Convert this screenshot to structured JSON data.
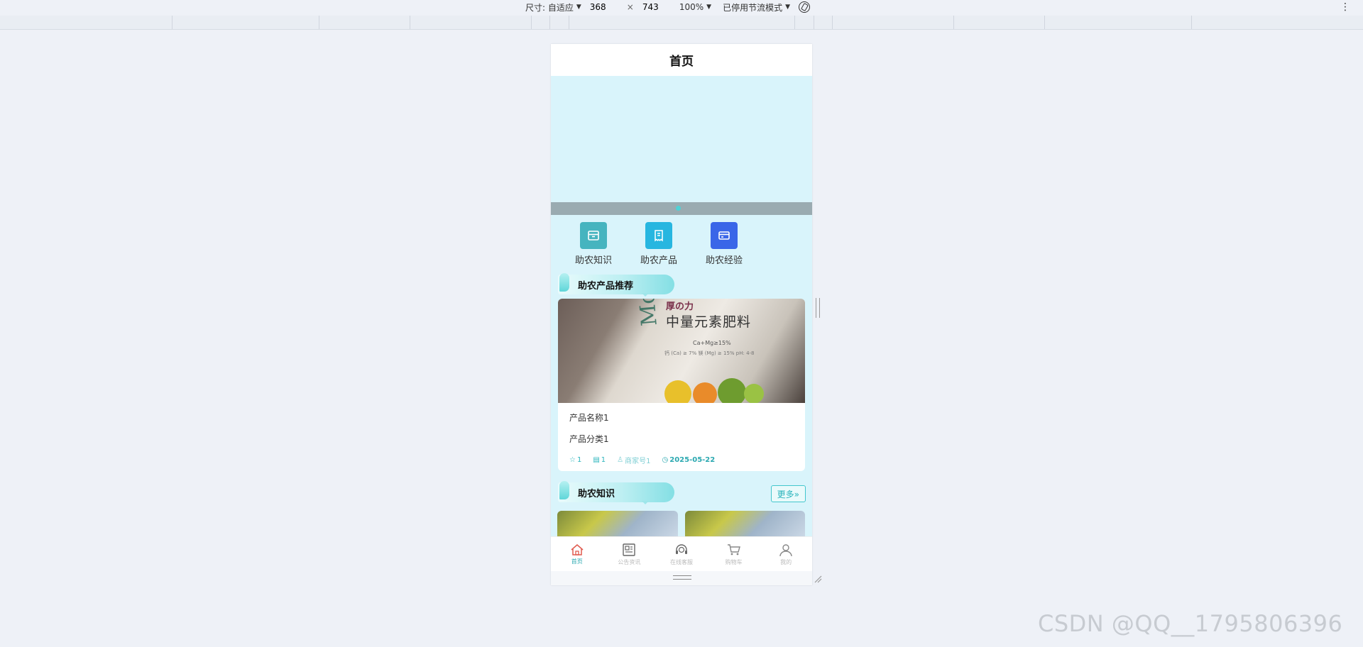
{
  "devtools": {
    "size_label": "尺寸: 自适应",
    "width_value": "368",
    "height_value": "743",
    "times_symbol": "×",
    "zoom": "100%",
    "throttle": "已停用节流模式"
  },
  "page": {
    "title": "首页"
  },
  "menu": [
    {
      "label": "助农知识",
      "icon": "storefront-icon",
      "color": "#46b4bf"
    },
    {
      "label": "助农产品",
      "icon": "receipt-icon",
      "color": "#27b6e0"
    },
    {
      "label": "助农经验",
      "icon": "card-icon",
      "color": "#3a66e8"
    }
  ],
  "product_section": {
    "title": "助农产品推荐"
  },
  "product": {
    "image_brand_text": "Modley",
    "image_title_text": "中量元素肥料",
    "image_top_text": "厚の力",
    "image_sub_text": "Ca+Mg≥15%",
    "image_line_text": "钙 (Ca) ≥ 7%  镁 (Mg) ≥ 15%   pH: 4-8",
    "name": "产品名称1",
    "category": "产品分类1",
    "favorites": "1",
    "comments": "1",
    "merchant": "商家号1",
    "date": "2025-05-22"
  },
  "knowledge_section": {
    "title": "助农知识",
    "more_label": "更多»"
  },
  "tabbar": [
    {
      "label": "首页",
      "active": true
    },
    {
      "label": "公告资讯",
      "active": false
    },
    {
      "label": "在线客服",
      "active": false
    },
    {
      "label": "购物车",
      "active": false
    },
    {
      "label": "我的",
      "active": false
    }
  ],
  "watermark": "CSDN @QQ__1795806396",
  "colors": {
    "accent": "#2ab4bc",
    "page_bg": "#d9f4fb"
  }
}
